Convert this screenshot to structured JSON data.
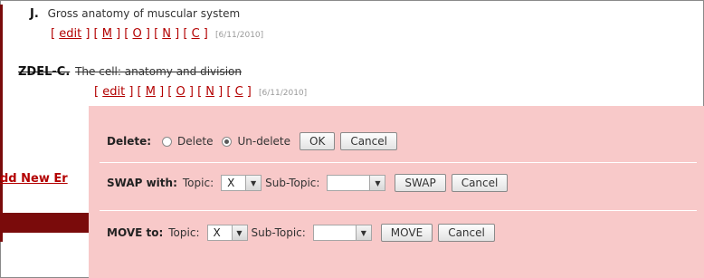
{
  "entries": [
    {
      "letter": "J.",
      "title": "Gross anatomy of muscular system",
      "links": [
        "edit",
        "M",
        "O",
        "N",
        "C"
      ],
      "date": "[6/11/2010]"
    },
    {
      "letter": "ZDEL-C.",
      "title": "The cell: anatomy and division",
      "links": [
        "edit",
        "M",
        "O",
        "N",
        "C"
      ],
      "date": "[6/11/2010]"
    }
  ],
  "add_new_label": "dd New Er",
  "panel": {
    "delete": {
      "label": "Delete:",
      "option_delete": "Delete",
      "option_undelete": "Un-delete",
      "ok_label": "OK",
      "cancel_label": "Cancel"
    },
    "swap": {
      "label": "SWAP with:",
      "topic_label": "Topic:",
      "topic_value": "X",
      "subtopic_label": "Sub-Topic:",
      "subtopic_value": "",
      "swap_label": "SWAP",
      "cancel_label": "Cancel"
    },
    "move": {
      "label": "MOVE to:",
      "topic_label": "Topic:",
      "topic_value": "X",
      "subtopic_label": "Sub-Topic:",
      "subtopic_value": "",
      "move_label": "MOVE",
      "cancel_label": "Cancel"
    }
  },
  "colors": {
    "link_red": "#b30000",
    "dark_red": "#7a0b0b",
    "panel_pink": "#f8c9c9"
  }
}
